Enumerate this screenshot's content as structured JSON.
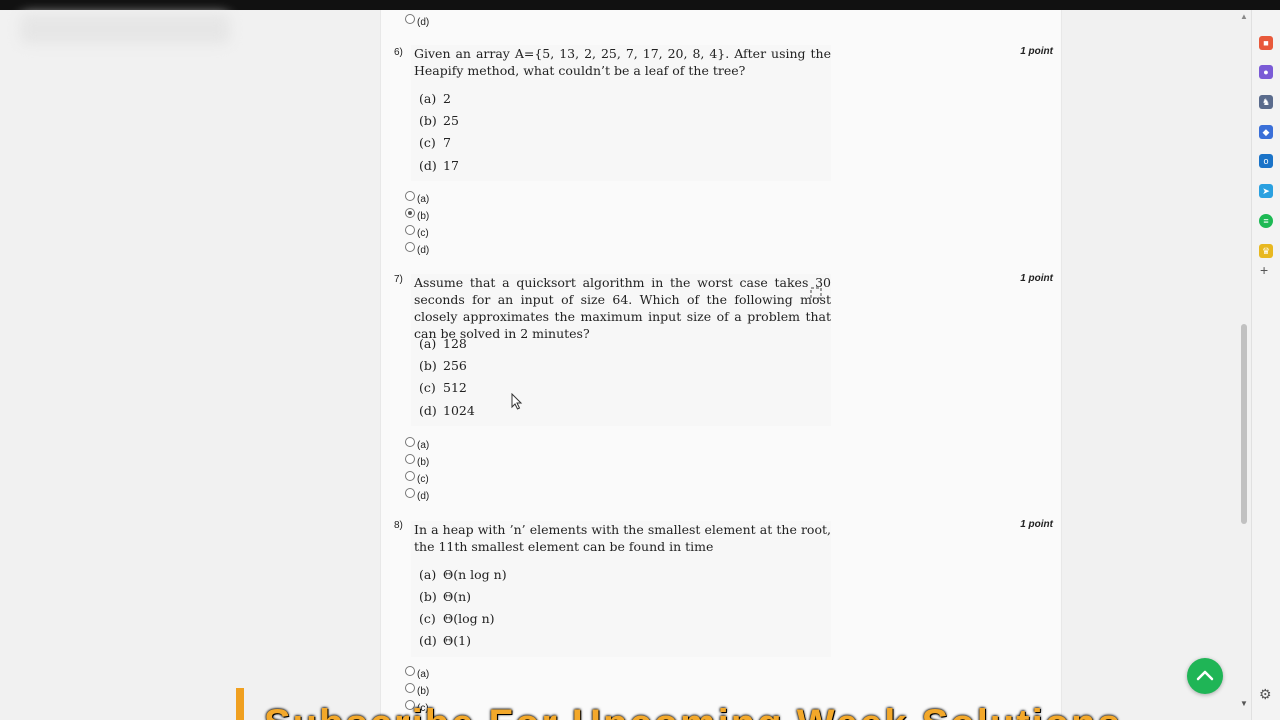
{
  "top_option": {
    "label": "(d)"
  },
  "questions": [
    {
      "number": "6)",
      "points": "1 point",
      "text": "Given an array A={5, 13, 2, 25, 7, 17, 20, 8, 4}. After using the Heapify method, what couldn’t be a leaf of the tree?",
      "options": [
        {
          "letter": "(a)",
          "text": "2"
        },
        {
          "letter": "(b)",
          "text": "25"
        },
        {
          "letter": "(c)",
          "text": "7"
        },
        {
          "letter": "(d)",
          "text": "17"
        }
      ],
      "radios": [
        {
          "label": "(a)",
          "checked": false
        },
        {
          "label": "(b)",
          "checked": true
        },
        {
          "label": "(c)",
          "checked": false
        },
        {
          "label": "(d)",
          "checked": false
        }
      ]
    },
    {
      "number": "7)",
      "points": "1 point",
      "text": "Assume that a quicksort algorithm in the worst case takes 30 seconds for an input of size 64. Which of the following most closely approximates the maximum input size of a problem that can be solved in 2 minutes?",
      "options": [
        {
          "letter": "(a)",
          "text": "128"
        },
        {
          "letter": "(b)",
          "text": "256"
        },
        {
          "letter": "(c)",
          "text": "512"
        },
        {
          "letter": "(d)",
          "text": "1024"
        }
      ],
      "radios": [
        {
          "label": "(a)",
          "checked": false
        },
        {
          "label": "(b)",
          "checked": false
        },
        {
          "label": "(c)",
          "checked": false
        },
        {
          "label": "(d)",
          "checked": false
        }
      ]
    },
    {
      "number": "8)",
      "points": "1 point",
      "text": "In a heap with ’n’ elements with the smallest element at the root, the 11th smallest element can be found in time",
      "options": [
        {
          "letter": "(a)",
          "text": "Θ(n log n)"
        },
        {
          "letter": "(b)",
          "text": "Θ(n)"
        },
        {
          "letter": "(c)",
          "text": "Θ(log n)"
        },
        {
          "letter": "(d)",
          "text": "Θ(1)"
        }
      ],
      "radios": [
        {
          "label": "(a)",
          "checked": false
        },
        {
          "label": "(b)",
          "checked": false
        },
        {
          "label": "(c)",
          "checked": false
        }
      ]
    }
  ],
  "sidebar_icons": [
    {
      "name": "briefcase-icon",
      "color": "#e8593b"
    },
    {
      "name": "people-icon",
      "color": "#7a5bd6"
    },
    {
      "name": "chess-icon",
      "color": "#5a6b8c"
    },
    {
      "name": "copilot-icon",
      "color": "#3a6fd8"
    },
    {
      "name": "outlook-icon",
      "color": "#1a73c8"
    },
    {
      "name": "telegram-icon",
      "color": "#2aa0e0"
    },
    {
      "name": "spotify-icon",
      "color": "#1db954"
    },
    {
      "name": "trophy-icon",
      "color": "#e8b820"
    }
  ],
  "banner": {
    "text": "Subscribe For Upcoming Week Solutions"
  },
  "colors": {
    "fab": "#1fb556",
    "banner": "#f3a82a"
  }
}
